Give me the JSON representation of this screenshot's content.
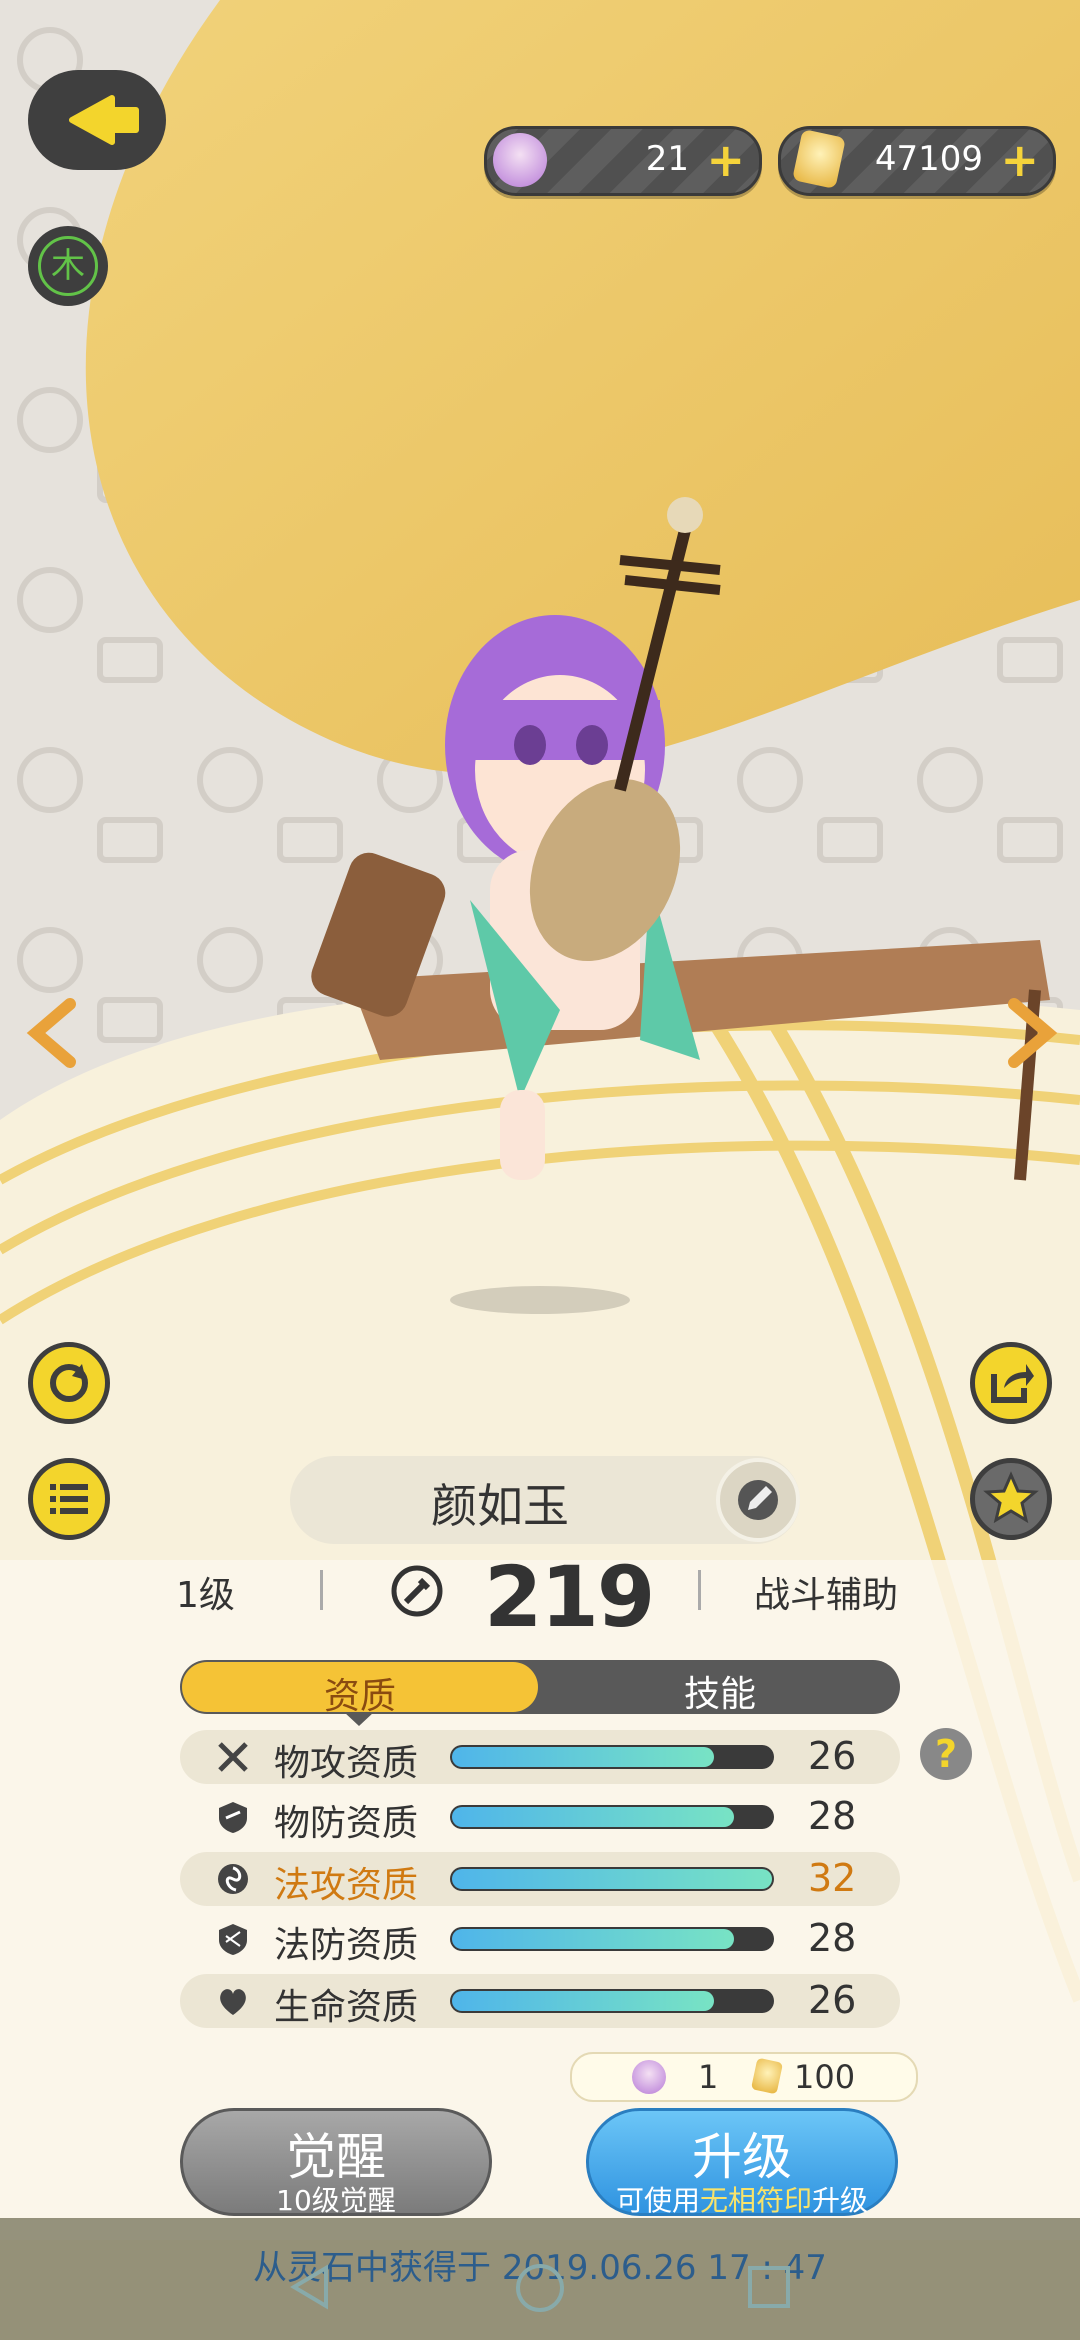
{
  "currency": {
    "spirits": "21",
    "crystals": "47109",
    "add_symbol": "+"
  },
  "element_badge": "木",
  "character": {
    "name": "颜如玉",
    "level": "1级",
    "power": "219",
    "role": "战斗辅助"
  },
  "tabs": [
    {
      "label": "资质",
      "active": true
    },
    {
      "label": "技能",
      "active": false
    }
  ],
  "attributes": [
    {
      "label": "物攻资质",
      "value": "26",
      "fill": 0.82,
      "icon": "swords-icon",
      "highlight": false
    },
    {
      "label": "物防资质",
      "value": "28",
      "fill": 0.88,
      "icon": "shield-icon",
      "highlight": false
    },
    {
      "label": "法攻资质",
      "value": "32",
      "fill": 1.0,
      "icon": "magic-swirl-icon",
      "highlight": true
    },
    {
      "label": "法防资质",
      "value": "28",
      "fill": 0.88,
      "icon": "magic-shield-icon",
      "highlight": false
    },
    {
      "label": "生命资质",
      "value": "26",
      "fill": 0.82,
      "icon": "heart-icon",
      "highlight": false
    }
  ],
  "help_symbol": "?",
  "cost": {
    "spirits": "1",
    "crystals": "100"
  },
  "buttons": {
    "awaken_title": "觉醒",
    "awaken_sub": "10级觉醒",
    "upgrade_title": "升级",
    "upgrade_sub_pre": "可使用",
    "upgrade_sub_em": "无相符印",
    "upgrade_sub_post": "升级"
  },
  "footer": "从灵石中获得于 2019.06.26  17 : 47",
  "colors": {
    "accent_yellow": "#f5c336",
    "highlight_orange": "#d07a12",
    "bar_start": "#4fb5ea",
    "bar_end": "#78e3c4",
    "upgrade_blue": "#39a8ee"
  }
}
